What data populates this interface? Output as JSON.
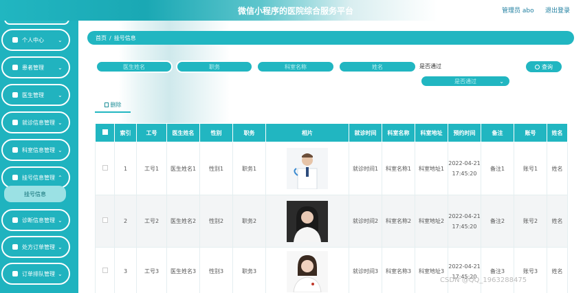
{
  "header": {
    "title": "微信小程序的医院综合服务平台",
    "user": "管理员 abo",
    "logout": "退出登录"
  },
  "sidebar": {
    "items": [
      {
        "label": "个人中心",
        "icon": "user-icon"
      },
      {
        "label": "患者管理",
        "icon": "list-icon"
      },
      {
        "label": "医生管理",
        "icon": "chat-icon"
      },
      {
        "label": "就诊信息管理",
        "icon": "calendar-icon"
      },
      {
        "label": "科室信息管理",
        "icon": "user-icon"
      },
      {
        "label": "挂号信息管理",
        "icon": "clipboard-icon"
      },
      {
        "label": "诊断信息管理",
        "icon": "send-icon"
      },
      {
        "label": "处方订单管理",
        "icon": "grid-icon"
      },
      {
        "label": "订单排队管理",
        "icon": "grid-icon"
      }
    ],
    "submenu": "挂号信息"
  },
  "breadcrumb": {
    "home": "首页",
    "sep": "/",
    "current": "挂号信息"
  },
  "filters": {
    "doctor_name": "医生姓名",
    "position": "职务",
    "dept_name": "科室名称",
    "name": "姓名",
    "approved_label": "是否通过",
    "approved_placeholder": "是否通过",
    "query": "查询"
  },
  "actions": {
    "delete": "删除"
  },
  "table": {
    "headers": [
      "索引",
      "工号",
      "医生姓名",
      "性别",
      "职务",
      "相片",
      "就诊时间",
      "科室名称",
      "科室地址",
      "预约时间",
      "备注",
      "账号",
      "姓名"
    ],
    "rows": [
      {
        "index": "1",
        "id": "工号1",
        "doctor": "医生姓名1",
        "gender": "性别1",
        "position": "职务1",
        "visit_time": "就诊时间1",
        "dept": "科室名称1",
        "address": "科室地址1",
        "appt": "2022-04-21 17:45:20",
        "note": "备注1",
        "account": "账号1",
        "name": "姓名"
      },
      {
        "index": "2",
        "id": "工号2",
        "doctor": "医生姓名2",
        "gender": "性别2",
        "position": "职务2",
        "visit_time": "就诊时间2",
        "dept": "科室名称2",
        "address": "科室地址2",
        "appt": "2022-04-21 17:45:20",
        "note": "备注2",
        "account": "账号2",
        "name": "姓名"
      },
      {
        "index": "3",
        "id": "工号3",
        "doctor": "医生姓名3",
        "gender": "性别3",
        "position": "职务3",
        "visit_time": "就诊时间3",
        "dept": "科室名称3",
        "address": "科室地址3",
        "appt": "2022-04-21 17:45:20",
        "note": "备注3",
        "account": "账号3",
        "name": "姓名"
      }
    ]
  },
  "watermark": "CSDN @QQ_1963288475",
  "colors": {
    "accent": "#21b6c1",
    "header_text": "#1f7fa0"
  }
}
